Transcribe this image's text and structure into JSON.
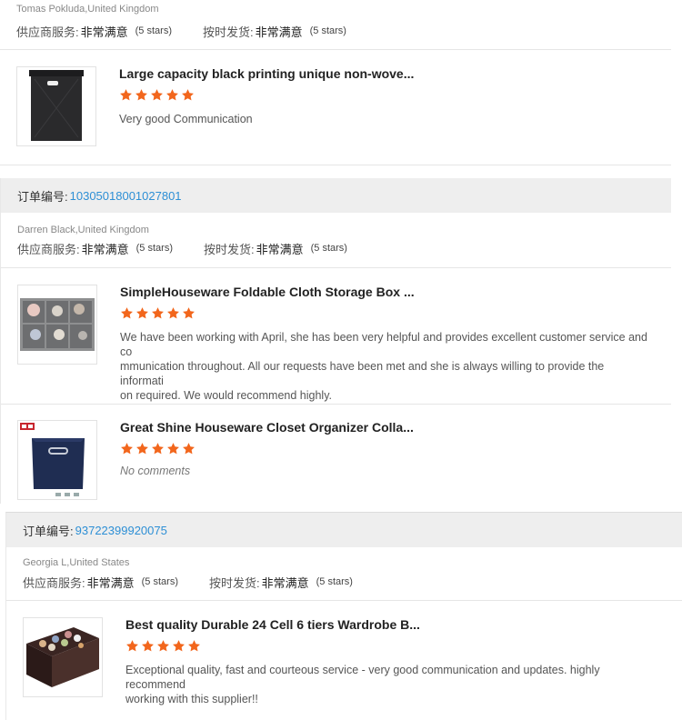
{
  "rating_labels": {
    "service": "供应商服务:",
    "shipping": "按时发货:"
  },
  "orders": [
    {
      "buyer": "Tomas Pokluda,United Kingdom",
      "service_value": "非常满意",
      "service_stars": "(5 stars)",
      "shipping_value": "非常满意",
      "shipping_stars": "(5 stars)",
      "items": [
        {
          "title": "Large capacity black printing unique non-wove...",
          "stars": 5,
          "comment": "Very good Communication",
          "thumb_icon": "black-storage-bin-icon"
        }
      ]
    },
    {
      "order_label": "订单编号:",
      "order_number": "10305018001027801",
      "buyer": "Darren Black,United Kingdom",
      "service_value": "非常满意",
      "service_stars": "(5 stars)",
      "shipping_value": "非常满意",
      "shipping_stars": "(5 stars)",
      "items": [
        {
          "title": "SimpleHouseware Foldable Cloth Storage Box ...",
          "stars": 5,
          "comment_lines": [
            "We have been working with April, she has been very helpful and provides excellent customer service and co",
            "mmunication throughout. All our requests have been met and she is always willing to provide the informati",
            "on required. We would recommend highly."
          ],
          "thumb_icon": "storage-box-set-icon"
        },
        {
          "title": "Great Shine Houseware Closet Organizer Colla...",
          "stars": 5,
          "comment": "No comments",
          "thumb_icon": "navy-cube-bin-icon"
        }
      ]
    },
    {
      "order_label": "订单编号:",
      "order_number": "93722399920075",
      "buyer": "Georgia L,United States",
      "service_value": "非常满意",
      "service_stars": "(5 stars)",
      "shipping_value": "非常满意",
      "shipping_stars": "(5 stars)",
      "items": [
        {
          "title": "Best quality Durable 24 Cell 6 tiers Wardrobe B...",
          "stars": 5,
          "comment_lines": [
            "Exceptional quality, fast and courteous service - very good communication and updates. highly recommend",
            "working with this supplier!!"
          ],
          "thumb_icon": "drawer-organizer-icon"
        }
      ]
    }
  ],
  "colors": {
    "star": "#f2661c",
    "order_number": "#2d8fd5",
    "order_bar_bg": "#eeeeee"
  }
}
